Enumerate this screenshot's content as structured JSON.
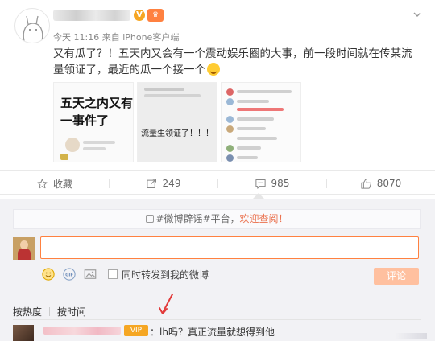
{
  "post": {
    "author_name": "",
    "meta": "今天 11:16 来自 iPhone客户端",
    "text": "又有瓜了？！五天内又会有一个震动娱乐圈的大事，前一段时间就在传某流量领证了，最近的瓜一个接一个",
    "images": [
      {
        "caption": "五天之内又有一事件了"
      },
      {
        "caption": "流量生领证了！！！"
      },
      {
        "caption": ""
      }
    ]
  },
  "actions": {
    "favorite_label": "收藏",
    "repost_count": "249",
    "comment_count": "985",
    "like_count": "8070"
  },
  "comment_box": {
    "notice_prefix": "#微博辟谣#平台，",
    "notice_link": "欢迎查阅！",
    "input_value": "",
    "repost_label": "同时转发到我的微博",
    "submit_label": "评论"
  },
  "sort": {
    "hot_label": "按热度",
    "time_label": "按时间"
  },
  "comments": [
    {
      "badge": "VIP",
      "text": "：lh吗？真正流量就想得到他"
    }
  ],
  "colors": {
    "accent": "#ff8140",
    "highlight": "#eb7350",
    "arrow": "#e23b3b",
    "submit_disabled": "#ffc09f"
  }
}
